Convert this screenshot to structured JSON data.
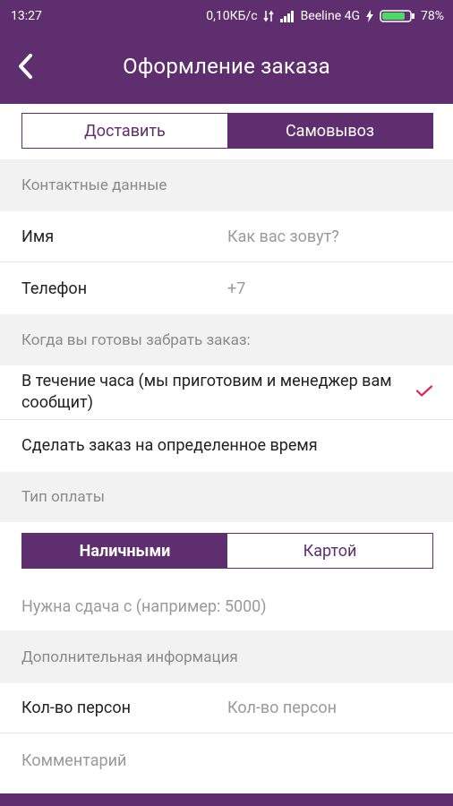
{
  "status_bar": {
    "time": "13:27",
    "network_speed": "0,10КБ/с",
    "carrier": "Beeline 4G",
    "battery": "78%"
  },
  "header": {
    "title": "Оформление заказа",
    "back_icon": "back-chevron-icon"
  },
  "delivery_toggle": {
    "options": [
      "Доставить",
      "Самовывоз"
    ],
    "selected": "Самовывоз"
  },
  "contact": {
    "section_title": "Контактные данные",
    "name_label": "Имя",
    "name_placeholder": "Как вас зовут?",
    "phone_label": "Телефон",
    "phone_placeholder": "+7"
  },
  "pickup_time": {
    "section_title": "Когда вы готовы забрать заказ:",
    "options": [
      {
        "label": "В течение часа (мы приготовим и менеджер вам сообщит)",
        "selected": true
      },
      {
        "label": "Сделать заказ на определенное время",
        "selected": false
      }
    ]
  },
  "payment": {
    "section_title": "Тип оплаты",
    "options": [
      "Наличными",
      "Картой"
    ],
    "selected": "Наличными",
    "change_placeholder": "Нужна сдача с (например: 5000)"
  },
  "extra": {
    "section_title": "Дополнительная информация",
    "persons_label": "Кол-во персон",
    "persons_placeholder": "Кол-во персон",
    "comment_placeholder": "Комментарий"
  },
  "colors": {
    "primary": "#5e2e6f",
    "check": "#e0245e"
  }
}
